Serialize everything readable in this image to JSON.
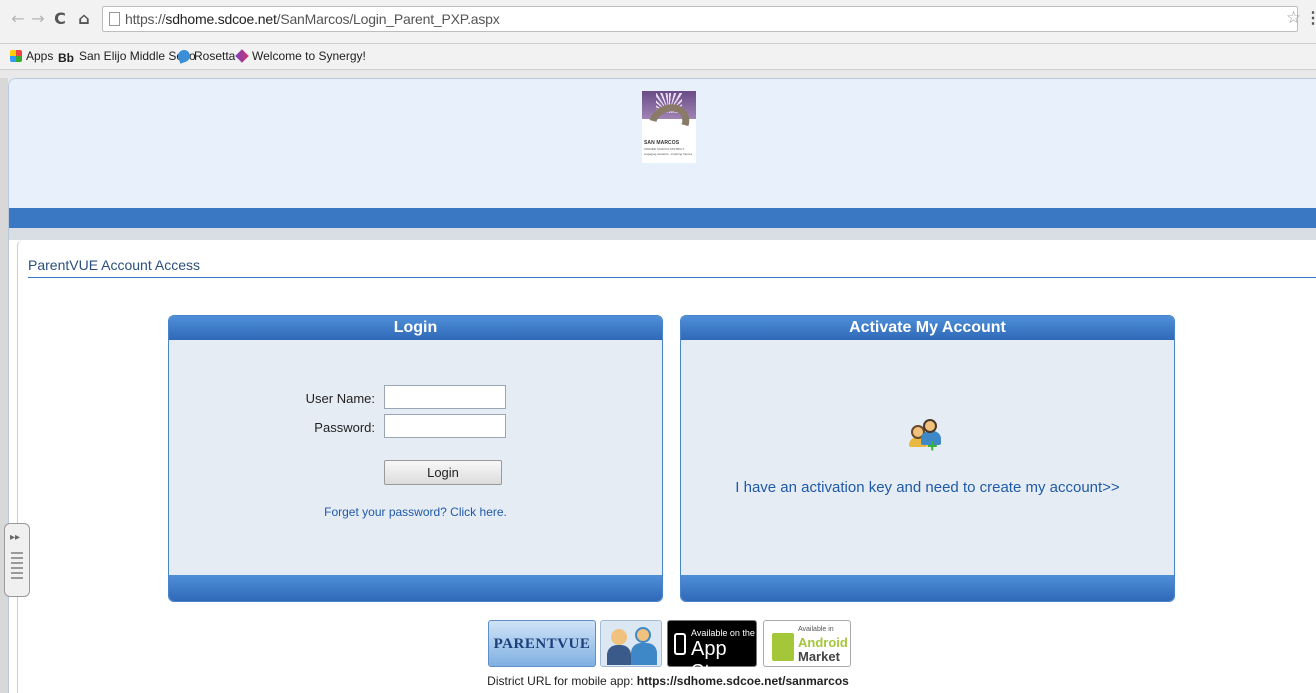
{
  "browser": {
    "url_prefix": "https://",
    "url_host": "sdhome.sdcoe.net",
    "url_path": "/SanMarcos/Login_Parent_PXP.aspx",
    "icons": {
      "back": "back-arrow-icon",
      "forward": "forward-arrow-icon",
      "reload": "reload-icon",
      "home": "home-icon",
      "star": "bookmark-star-icon",
      "menu": "menu-icon"
    },
    "bookmarks": [
      {
        "label": "Apps",
        "icon": "apps-grid-icon"
      },
      {
        "label": "San Elijo Middle Scho",
        "icon": "blackboard-icon",
        "prefix": "Bb"
      },
      {
        "label": "Rosetta",
        "icon": "rosetta-icon"
      },
      {
        "label": "Welcome to Synergy!",
        "icon": "synergy-icon"
      }
    ]
  },
  "header": {
    "logo": {
      "name": "SAN MARCOS",
      "sub": "UNIFIED SCHOOL DISTRICT",
      "tagline": "engaging students...inspiring futures"
    }
  },
  "page": {
    "section_title": "ParentVUE Account Access"
  },
  "login": {
    "title": "Login",
    "username_label": "User Name:",
    "password_label": "Password:",
    "username_value": "",
    "password_value": "",
    "button_label": "Login",
    "forgot_link": "Forget your password? Click here."
  },
  "activate": {
    "title": "Activate My Account",
    "link": "I have an activation key and need to create my account>>",
    "icon": "add-user-icon"
  },
  "badges": {
    "parentvue": "PARENTVUE",
    "appstore_small": "Available on the",
    "appstore_big": "App Store",
    "android_small": "Available in",
    "android_line1": "Android",
    "android_line2": "Market"
  },
  "footer": {
    "district_label": "District URL for mobile app:",
    "district_url": "https://sdhome.sdcoe.net/sanmarcos"
  },
  "colors": {
    "accent_blue": "#3b78c4",
    "link_blue": "#1f5aa8",
    "header_bg": "#e8f0fb",
    "panel_bg": "#e6ecf4"
  }
}
